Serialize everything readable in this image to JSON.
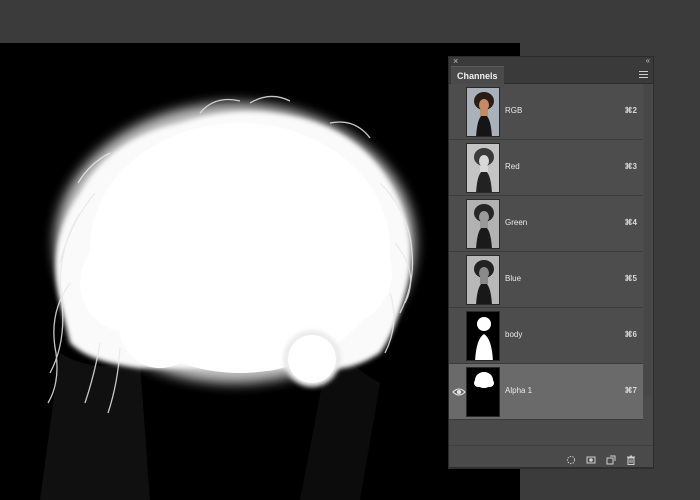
{
  "panel": {
    "close_glyph": "×",
    "collapse_glyph": "‹‹",
    "tab_label": "Channels",
    "menu_icon": "hamburger-icon"
  },
  "channels": [
    {
      "name": "RGB",
      "shortcut": "⌘2",
      "thumb": "color-portrait",
      "visible": false,
      "active": false
    },
    {
      "name": "Red",
      "shortcut": "⌘3",
      "thumb": "gray-portrait-light",
      "visible": false,
      "active": false
    },
    {
      "name": "Green",
      "shortcut": "⌘4",
      "thumb": "gray-portrait",
      "visible": false,
      "active": false
    },
    {
      "name": "Blue",
      "shortcut": "⌘5",
      "thumb": "gray-portrait",
      "visible": false,
      "active": false
    },
    {
      "name": "body",
      "shortcut": "⌘6",
      "thumb": "body-mask",
      "visible": false,
      "active": false
    },
    {
      "name": "Alpha 1",
      "shortcut": "⌘7",
      "thumb": "hair-mask",
      "visible": true,
      "active": true
    }
  ],
  "footer_icons": [
    "load-selection-icon",
    "save-selection-icon",
    "new-channel-icon",
    "trash-icon"
  ],
  "colors": {
    "panel_bg": "#4a4a4a",
    "active_row": "#6a6a6a",
    "canvas_bg": "#000000",
    "workspace_bg": "#3b3b3b"
  }
}
